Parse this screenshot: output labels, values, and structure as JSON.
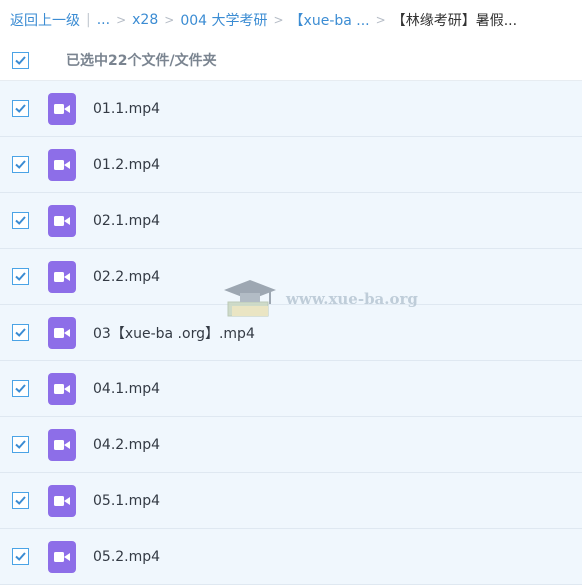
{
  "breadcrumb": {
    "back": "返回上一级",
    "ellipsis": "...",
    "items": [
      "x28",
      "004 大学考研",
      "【xue-ba ..."
    ],
    "current": "【林缘考研】暑假..."
  },
  "selection": {
    "label": "已选中22个文件/文件夹"
  },
  "files": [
    {
      "name": "01.1.mp4"
    },
    {
      "name": "01.2.mp4"
    },
    {
      "name": "02.1.mp4"
    },
    {
      "name": "02.2.mp4"
    },
    {
      "name": "03【xue-ba .org】.mp4"
    },
    {
      "name": "04.1.mp4"
    },
    {
      "name": "04.2.mp4"
    },
    {
      "name": "05.1.mp4"
    },
    {
      "name": "05.2.mp4"
    }
  ],
  "watermark": {
    "text": "www.xue-ba.org",
    "icon": "graduation-cap-icon"
  },
  "colors": {
    "accent": "#3b8cd3",
    "row_bg": "#f0f7fd",
    "video_icon": "#8d6ee8"
  }
}
